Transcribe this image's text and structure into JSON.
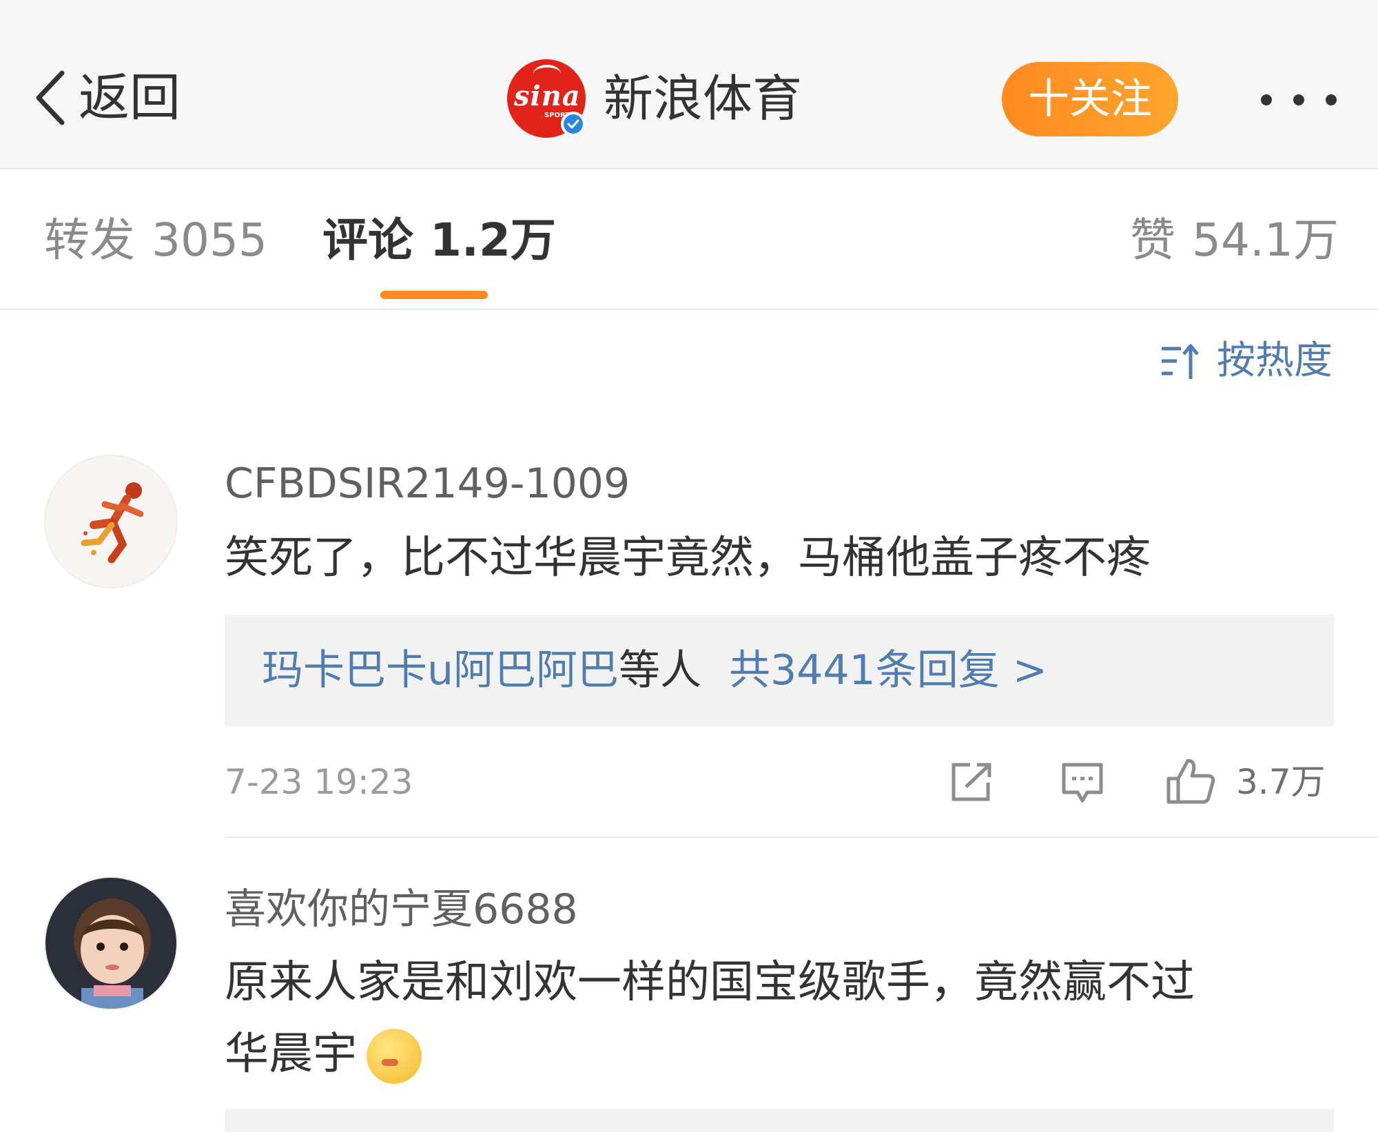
{
  "header": {
    "back_label": "返回",
    "account_name": "新浪体育",
    "account_logo_text": "sina",
    "account_logo_sub": "SPORT",
    "follow_label": "十关注",
    "more_icon": "more-dots-icon"
  },
  "tabs": {
    "repost": {
      "label": "转发",
      "count": "3055"
    },
    "comment": {
      "label": "评论",
      "count": "1.2万"
    },
    "like": {
      "label": "赞",
      "count": "54.1万"
    }
  },
  "sort": {
    "label": "按热度",
    "icon": "sort-icon"
  },
  "comments": [
    {
      "username": "CFBDSIR2149-1009",
      "text": "笑死了，比不过华晨宇竟然，马桶他盖子疼不疼",
      "replies": {
        "users": "玛卡巴卡u阿巴阿巴",
        "suffix": "等人",
        "count_label": "共3441条回复 >"
      },
      "timestamp": "7-23 19:23",
      "like_count": "3.7万"
    },
    {
      "username": "喜欢你的宁夏6688",
      "text_line1": "原来人家是和刘欢一样的国宝级歌手，竟然赢不过",
      "text_line2": "华晨宇"
    }
  ],
  "colors": {
    "accent_orange": "#ff8a1f",
    "link_blue": "#507daf",
    "brand_red": "#e2231a",
    "verified_blue": "#2b86e0"
  }
}
